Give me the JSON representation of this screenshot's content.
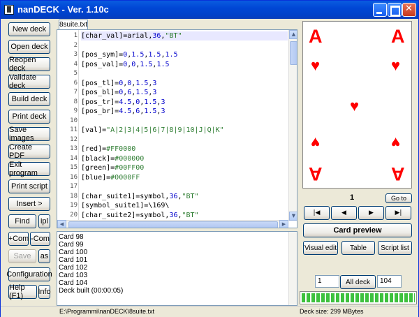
{
  "window": {
    "title": "nanDECK - Ver. 1.10c"
  },
  "left_buttons": [
    "New deck",
    "Open deck",
    "Reopen deck",
    "Validate deck",
    "Build deck",
    "Print deck",
    "Save images",
    "Create PDF",
    "Exit program",
    "Print script",
    "Insert >"
  ],
  "small_buttons": {
    "find": "Find",
    "ipl": "ipl",
    "add_com": "+Com",
    "sub_com": "-Com",
    "save": "Save",
    "as": "as",
    "configuration": "Configuration",
    "help": "Help (F1)",
    "info": "Info"
  },
  "editor": {
    "tab": "8suite.txt",
    "lines": [
      {
        "n": "1",
        "text": "[char_val]=arial,36,\"BT\""
      },
      {
        "n": "2",
        "text": ""
      },
      {
        "n": "3",
        "text": "[pos_sym]=0,1.5,1.5,1.5"
      },
      {
        "n": "4",
        "text": "[pos_val]=0,0,1.5,1.5"
      },
      {
        "n": "5",
        "text": ""
      },
      {
        "n": "6",
        "text": "[pos_tl]=0,0,1.5,3"
      },
      {
        "n": "7",
        "text": "[pos_bl]=0,6,1.5,3"
      },
      {
        "n": "8",
        "text": "[pos_tr]=4.5,0,1.5,3"
      },
      {
        "n": "9",
        "text": "[pos_br]=4.5,6,1.5,3"
      },
      {
        "n": "10",
        "text": ""
      },
      {
        "n": "11",
        "text": "[val]=\"A|2|3|4|5|6|7|8|9|10|J|Q|K\""
      },
      {
        "n": "12",
        "text": ""
      },
      {
        "n": "13",
        "text": "[red]=#FF0000"
      },
      {
        "n": "14",
        "text": "[black]=#000000"
      },
      {
        "n": "15",
        "text": "[green]=#00FF00"
      },
      {
        "n": "16",
        "text": "[blue]=#0000FF"
      },
      {
        "n": "17",
        "text": ""
      },
      {
        "n": "18",
        "text": "[char_suite1]=symbol,36,\"BT\""
      },
      {
        "n": "19",
        "text": "[symbol_suite1]=\\169\\"
      },
      {
        "n": "20",
        "text": "[char_suite2]=symbol,36,\"BT\""
      }
    ]
  },
  "log": [
    "Card 98",
    "Card 99",
    "Card 100",
    "Card 101",
    "Card 102",
    "Card 103",
    "Card 104",
    "Deck built (00:00:05)"
  ],
  "preview": {
    "rank": "A",
    "suit_symbol": "♥",
    "suit_color": "#FF0000"
  },
  "nav": {
    "page": "1",
    "goto": "Go to",
    "first": "|◀",
    "prev": "◀",
    "next": "▶",
    "last": "▶|"
  },
  "preview_buttons": {
    "card_preview": "Card preview",
    "visual_edit": "Visual edit",
    "table": "Table",
    "script_list": "Script list"
  },
  "range": {
    "from": "1",
    "all_deck": "All deck",
    "to": "104"
  },
  "progress": {
    "fraction": 1.0
  },
  "status": {
    "path": "E:\\Programmi\\nanDECK\\8suite.txt",
    "size": "Deck size: 299 MBytes"
  }
}
